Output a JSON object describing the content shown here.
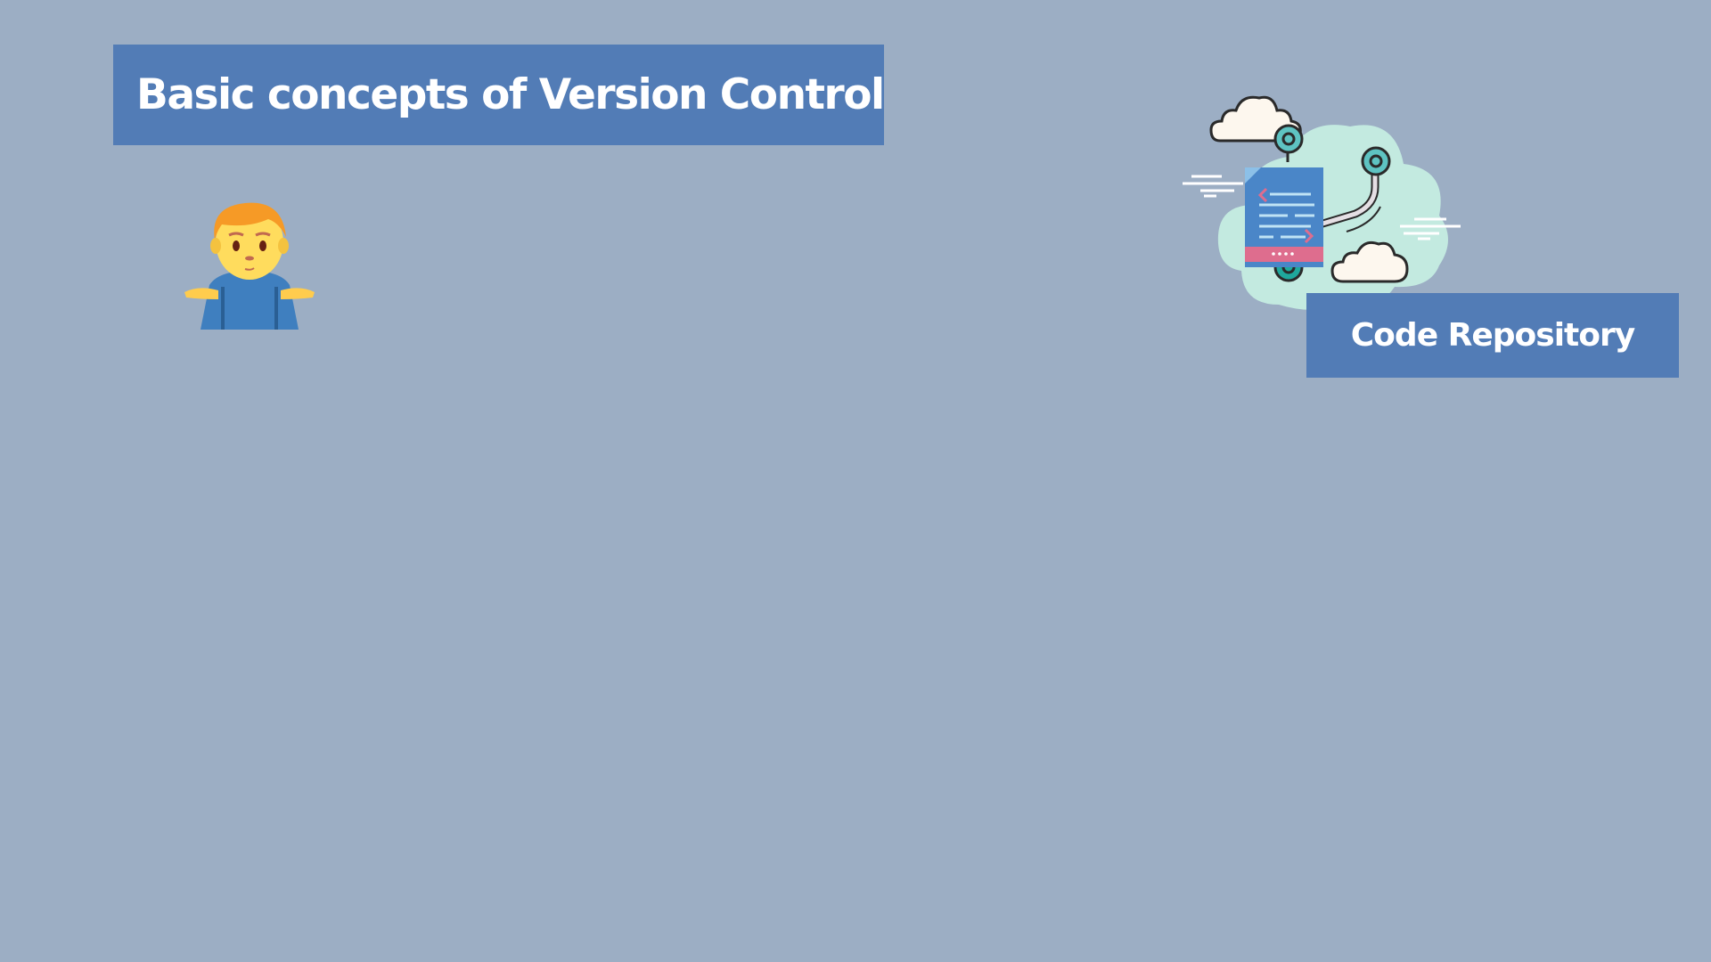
{
  "slide": {
    "title": "Basic concepts of Version Control",
    "repo_label": "Code Repository",
    "icons": {
      "person": "person-shrugging-icon",
      "repository": "code-repository-cloud-icon"
    },
    "colors": {
      "background": "#9caec4",
      "banner": "#527cb6",
      "banner_text": "#ffffff"
    }
  }
}
